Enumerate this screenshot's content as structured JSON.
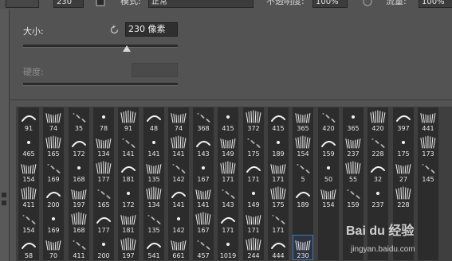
{
  "options_bar": {
    "brush_size": "230",
    "mode_label": "模式:",
    "mode_value": "正常",
    "opacity_label": "不透明度:",
    "opacity_value": "100%",
    "flow_label": "流量:",
    "flow_value": "100%"
  },
  "brush_panel": {
    "size_label": "大小:",
    "size_value": "230 像素",
    "hardness_label": "硬度:",
    "size_slider_fraction": 0.67
  },
  "presets": {
    "rows": [
      [
        "91",
        "74",
        "35",
        "78",
        "91",
        "48",
        "74",
        "368",
        "415",
        "372",
        "415",
        "365",
        "420",
        "365",
        "420",
        "397",
        "441"
      ],
      [
        "465",
        "165",
        "172",
        "134",
        "141",
        "141",
        "141",
        "143",
        "149",
        "175",
        "189",
        "154",
        "159",
        "237",
        "228",
        "175",
        "173"
      ],
      [
        "154",
        "169",
        "168",
        "177",
        "181",
        "135",
        "142",
        "167",
        "171",
        "171",
        "171",
        "5",
        "50",
        "55",
        "32",
        "27",
        "145"
      ],
      [
        "411",
        "200",
        "197",
        "165",
        "172",
        "134",
        "141",
        "141",
        "143",
        "149",
        "175",
        "189",
        "154",
        "159",
        "237",
        "228",
        ""
      ],
      [
        "154",
        "169",
        "168",
        "177",
        "181",
        "135",
        "142",
        "167",
        "171",
        "171",
        "171",
        "",
        "",
        "",
        "",
        "",
        ""
      ],
      [
        "58",
        "70",
        "411",
        "200",
        "197",
        "541",
        "661",
        "457",
        "1019",
        "244",
        "444",
        "230",
        "",
        "",
        "",
        "",
        ""
      ]
    ],
    "selected": "230"
  },
  "watermark": {
    "logo": "Bai du 经验",
    "url": "jingyan.baidu.com"
  },
  "colors": {
    "panel_bg": "#535353",
    "preset_bg": "#3f3f3f",
    "cell_bg": "#2c2c2c",
    "selection": "#3d78b8"
  }
}
